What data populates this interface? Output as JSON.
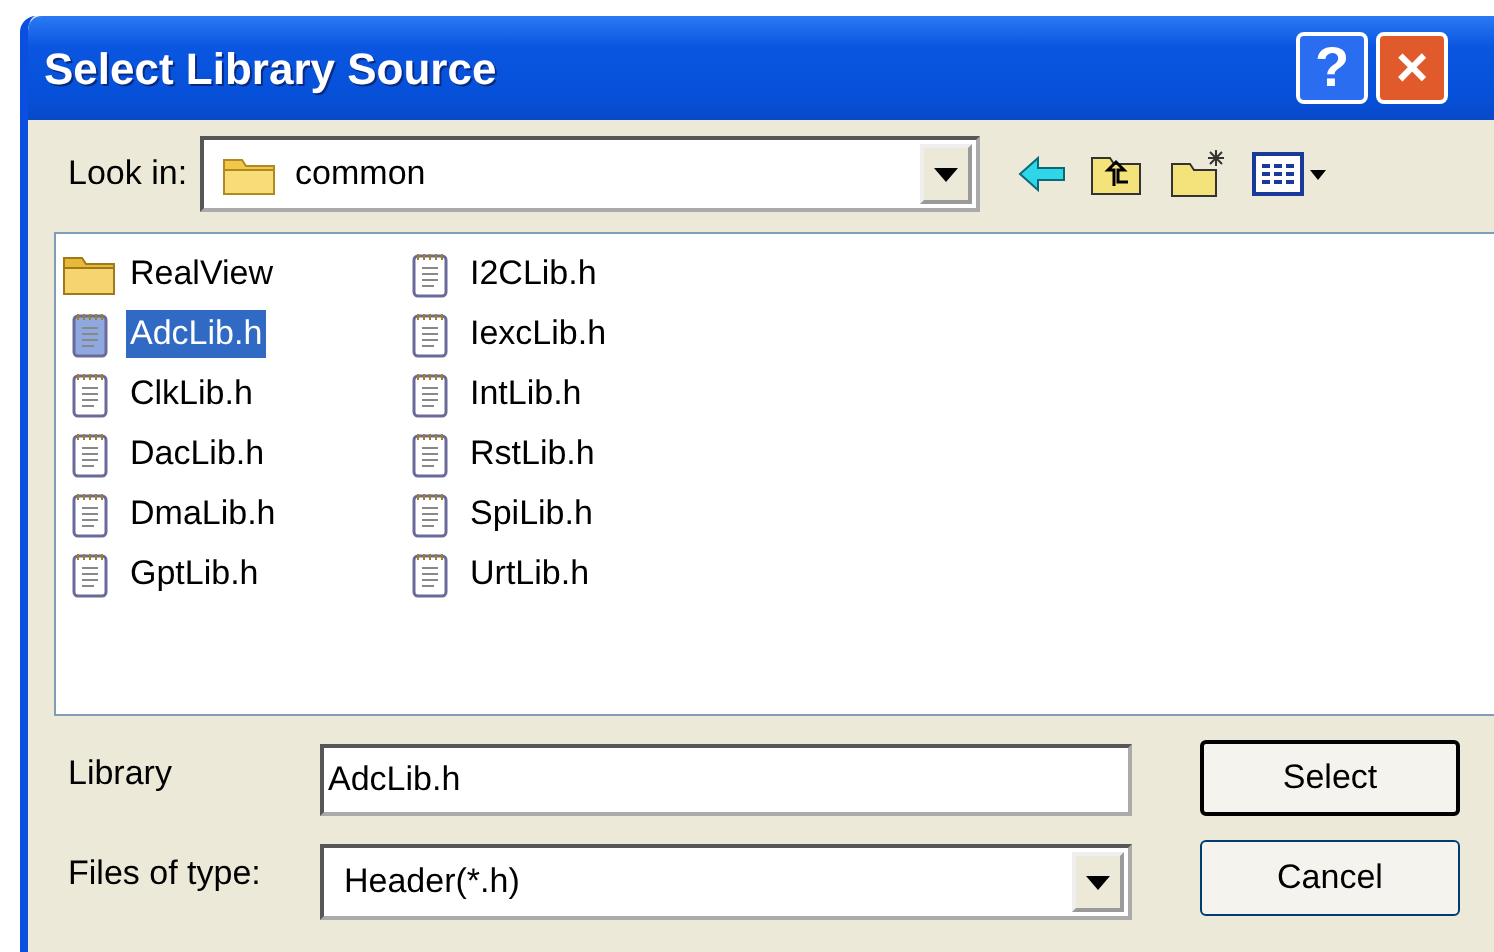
{
  "window": {
    "title": "Select Library Source",
    "help_button": "?",
    "close_button": "×"
  },
  "look_in": {
    "label": "Look in:",
    "value": "common"
  },
  "files": [
    {
      "name": "RealView",
      "kind": "folder",
      "selected": false
    },
    {
      "name": "AdcLib.h",
      "kind": "file",
      "selected": true
    },
    {
      "name": "ClkLib.h",
      "kind": "file",
      "selected": false
    },
    {
      "name": "DacLib.h",
      "kind": "file",
      "selected": false
    },
    {
      "name": "DmaLib.h",
      "kind": "file",
      "selected": false
    },
    {
      "name": "GptLib.h",
      "kind": "file",
      "selected": false
    },
    {
      "name": "I2CLib.h",
      "kind": "file",
      "selected": false
    },
    {
      "name": "IexcLib.h",
      "kind": "file",
      "selected": false
    },
    {
      "name": "IntLib.h",
      "kind": "file",
      "selected": false
    },
    {
      "name": "RstLib.h",
      "kind": "file",
      "selected": false
    },
    {
      "name": "SpiLib.h",
      "kind": "file",
      "selected": false
    },
    {
      "name": "UrtLib.h",
      "kind": "file",
      "selected": false
    }
  ],
  "library": {
    "label": "Library",
    "value": "AdcLib.h"
  },
  "files_of_type": {
    "label": "Files of type:",
    "value": "Header(*.h)"
  },
  "buttons": [
    {
      "label": "Select",
      "default": true
    },
    {
      "label": "Cancel",
      "default": false
    }
  ]
}
